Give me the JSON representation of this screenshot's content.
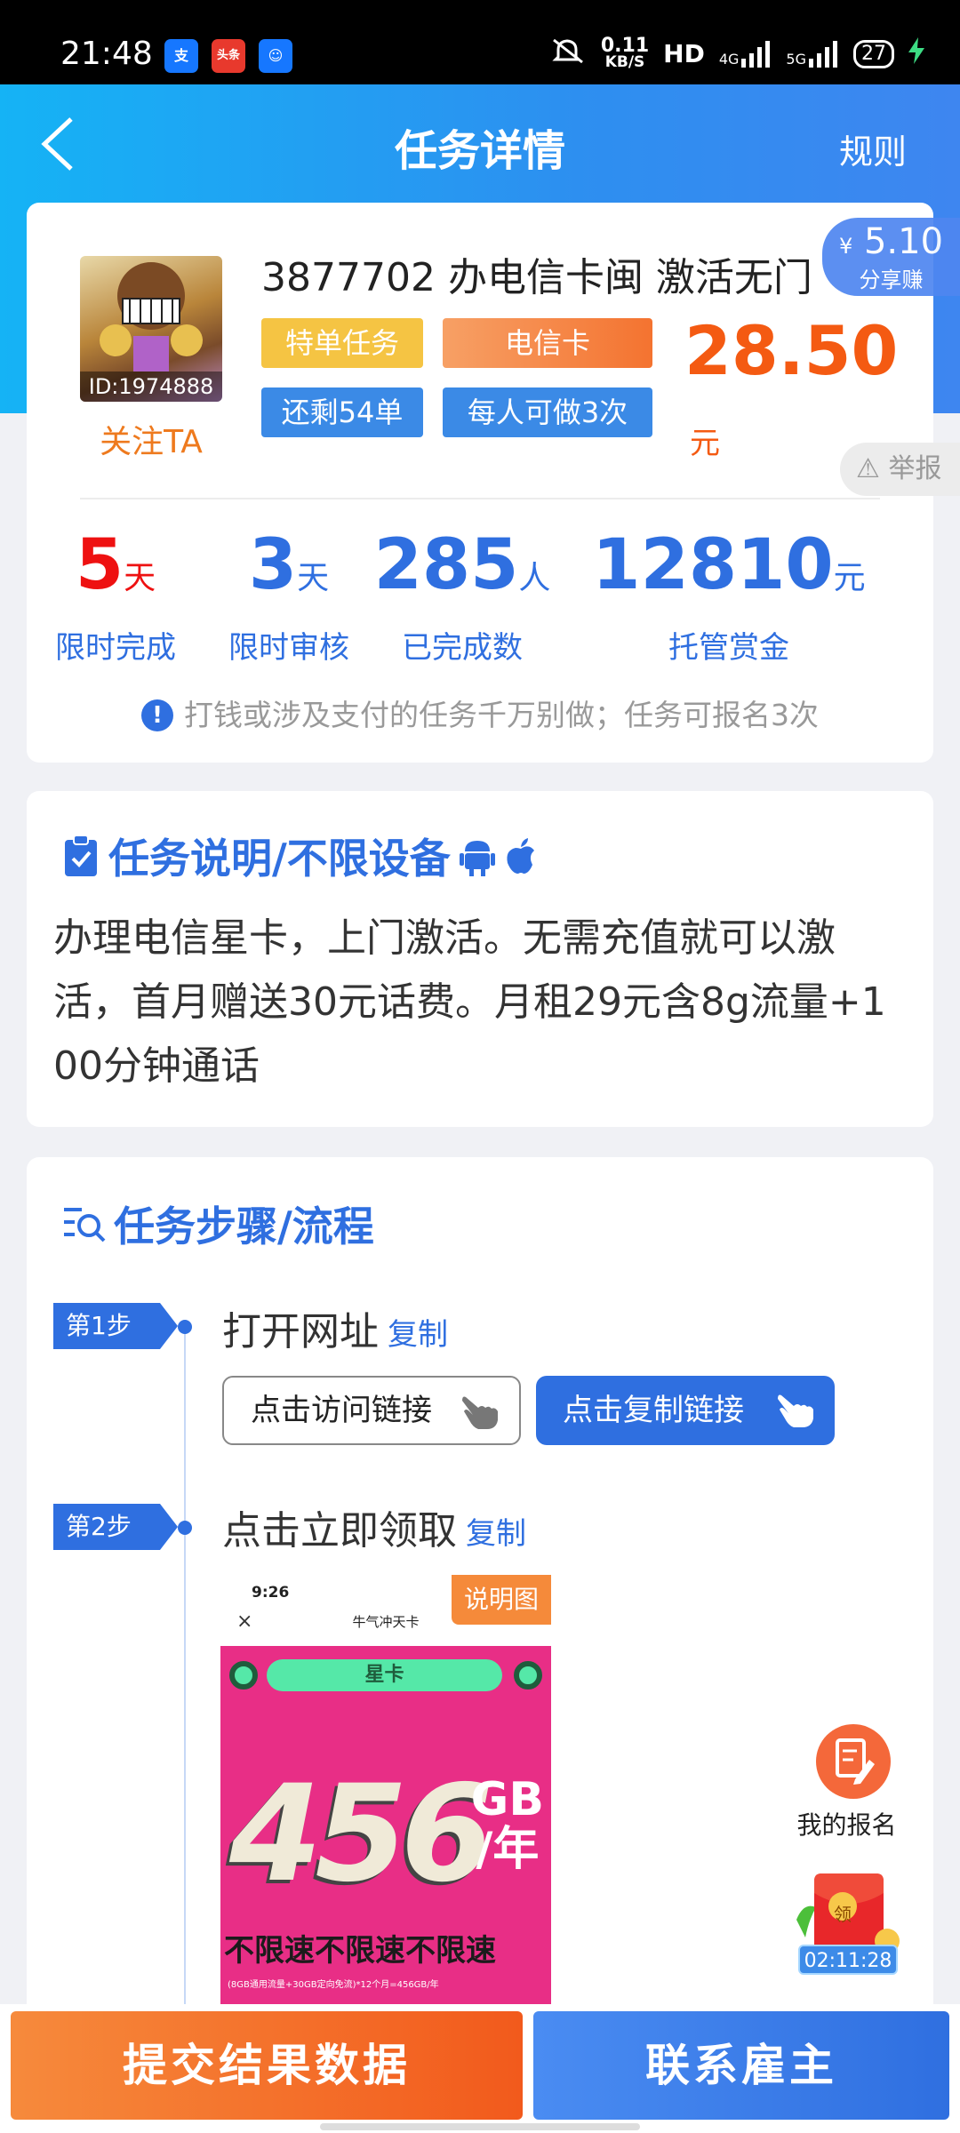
{
  "status_bar": {
    "time": "21:48",
    "apps": [
      {
        "name": "支",
        "color": "#1677ff"
      },
      {
        "name": "头条",
        "color": "#e8392d"
      },
      {
        "name": "☺",
        "color": "#1677ff"
      }
    ],
    "speed_value": "0.11",
    "speed_unit": "KB/S",
    "hd": "HD",
    "network1": "4G",
    "network2": "5G",
    "battery": "27"
  },
  "nav": {
    "title": "任务详情",
    "rules": "规则"
  },
  "task": {
    "avatar_id": "ID:1974888",
    "follow": "关注TA",
    "title": "3877702 办电信卡闽 激活无门",
    "tags": [
      "特单任务",
      "电信卡",
      "还剩54单",
      "每人可做3次"
    ],
    "price": "28.50",
    "price_unit": "元",
    "share_amount": "5.10",
    "share_symbol": "¥",
    "share_label": "分享赚",
    "report": "举报"
  },
  "stats": [
    {
      "value": "5",
      "unit": "天",
      "label": "限时完成",
      "color": "#ee1111"
    },
    {
      "value": "3",
      "unit": "天",
      "label": "限时审核",
      "color": "#2f6fe0"
    },
    {
      "value": "285",
      "unit": "人",
      "label": "已完成数",
      "color": "#2f6fe0"
    },
    {
      "value": "12810",
      "unit": "元",
      "label": "托管赏金",
      "color": "#2f6fe0"
    }
  ],
  "notice": "打钱或涉及支付的任务千万别做；任务可报名3次",
  "description": {
    "title": "任务说明/不限设备",
    "text": "办理电信星卡，上门激活。无需充值就可以激活，首月赠送30元话费。月租29元含8g流量+100分钟通话"
  },
  "steps": {
    "title": "任务步骤/流程",
    "items": [
      {
        "tag": "第1步",
        "text": "打开网址",
        "copy": "复制",
        "buttons": [
          "点击访问链接",
          "点击复制链接"
        ]
      },
      {
        "tag": "第2步",
        "text": "点击立即领取",
        "copy": "复制"
      }
    ],
    "image": {
      "label": "说明图",
      "time": "9:26",
      "close": "×",
      "app_title": "牛气冲天卡",
      "dots": "···",
      "band": "星卡",
      "big_number": "456",
      "gb": "GB",
      "per_year": "/年",
      "slogan": "不限速不限速不限速",
      "fine_print": "(8GB通用流量+30GB定向免流)*12个月=456GB/年"
    }
  },
  "floating": {
    "my_signup": "我的报名",
    "redpack_char": "领",
    "timer": "02:11:28"
  },
  "bottom": {
    "submit": "提交结果数据",
    "contact": "联系雇主"
  },
  "colors": {
    "accent": "#2f6fe0",
    "price": "#f45a12",
    "submit": "#f46a20",
    "contact": "#3b7ff0"
  }
}
